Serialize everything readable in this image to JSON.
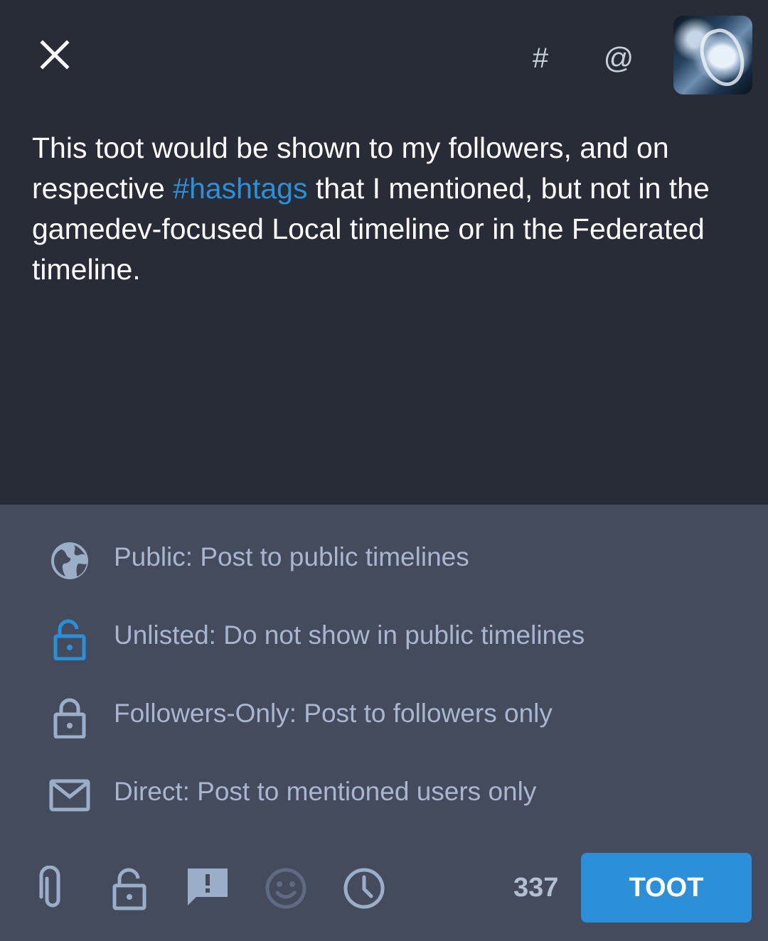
{
  "header": {
    "close_icon": "close-icon",
    "hashtag_symbol": "#",
    "mention_symbol": "@"
  },
  "compose": {
    "text_before": "This toot would be shown to my followers, and on respective ",
    "hashtag": "#hashtags",
    "text_after": " that I mentioned, but not in the gamedev-focused Local timeline or in the Federated timeline."
  },
  "visibility_menu": {
    "items": [
      {
        "icon": "globe-icon",
        "label": "Public: Post to public timelines",
        "color": "#9baec8"
      },
      {
        "icon": "unlock-icon",
        "label": "Unlisted: Do not show in public timelines",
        "color": "#2b90d9"
      },
      {
        "icon": "lock-icon",
        "label": "Followers-Only: Post to followers only",
        "color": "#9baec8"
      },
      {
        "icon": "envelope-icon",
        "label": "Direct: Post to mentioned users only",
        "color": "#9baec8"
      }
    ]
  },
  "toolbar": {
    "char_count": "337",
    "toot_label": "TOOT",
    "accent_color": "#2b90d9"
  }
}
